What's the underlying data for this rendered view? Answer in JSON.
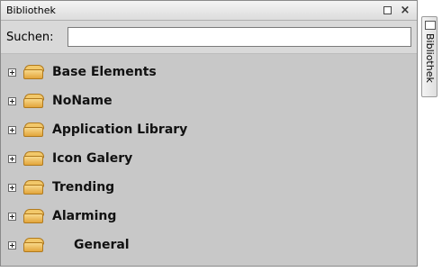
{
  "panel": {
    "title": "Bibliothek",
    "buttons": {
      "restore_icon": "restore-icon",
      "close_label": "×"
    }
  },
  "search": {
    "label": "Suchen:",
    "value": "",
    "placeholder": ""
  },
  "tree": [
    {
      "label": "Base Elements"
    },
    {
      "label": "NoName"
    },
    {
      "label": "Application Library"
    },
    {
      "label": "Icon Galery"
    },
    {
      "label": "Trending"
    },
    {
      "label": "Alarming"
    },
    {
      "label": "General"
    }
  ],
  "side_tab": {
    "label": "Bibliothek"
  },
  "colors": {
    "folder": "#f2c86a",
    "panel_bg": "#c8c8c8"
  }
}
